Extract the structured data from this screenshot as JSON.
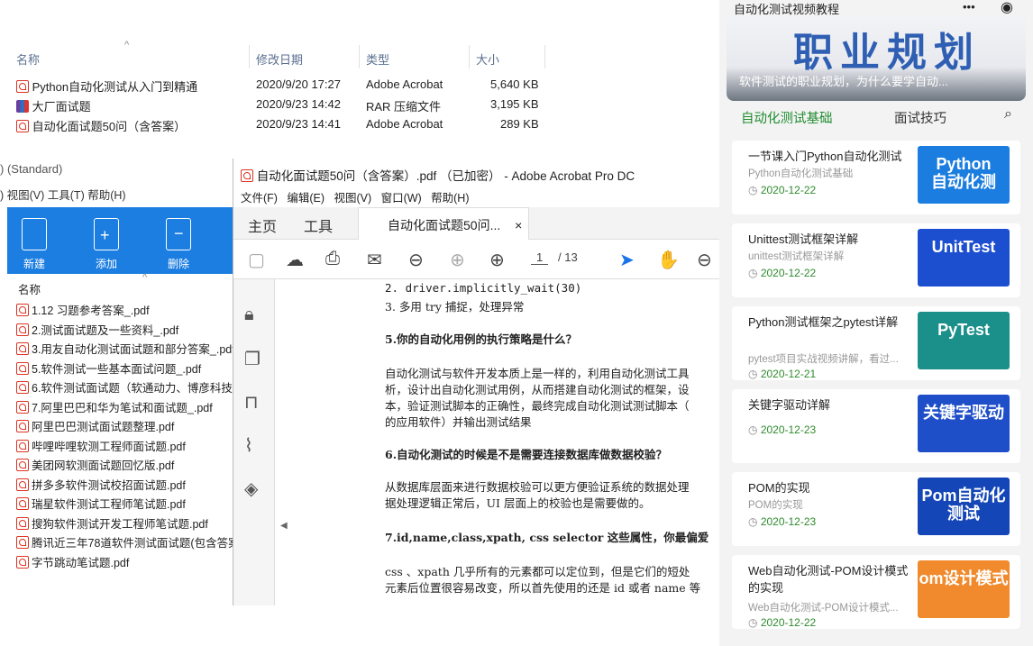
{
  "explorer": {
    "headers": {
      "name": "名称",
      "date": "修改日期",
      "type": "类型",
      "size": "大小"
    },
    "files": [
      {
        "icon": "pdf-icon",
        "name": "Python自动化测试从入门到精通",
        "date": "2020/9/20 17:27",
        "type": "Adobe Acrobat",
        "size": "5,640 KB"
      },
      {
        "icon": "rar-icon",
        "name": "大厂面试题",
        "date": "2020/9/23 14:42",
        "type": "RAR 压缩文件",
        "size": "3,195 KB"
      },
      {
        "icon": "pdf-icon",
        "name": "自动化面试题50问（含答案）",
        "date": "2020/9/23 14:41",
        "type": "Adobe Acrobat",
        "size": "289 KB"
      }
    ]
  },
  "win2": {
    "title": ") (Standard)",
    "menu": ") 视图(V) 工具(T) 帮助(H)",
    "ribbon": {
      "new": "新建",
      "add": "添加",
      "delete": "删除"
    },
    "list_header": "名称",
    "files": [
      "1.12 习题参考答案_.pdf",
      "2.测试面试题及一些资料_.pdf",
      "3.用友自动化测试面试题和部分答案_.pdf",
      "5.软件测试一些基本面试问题_.pdf",
      "6.软件测试面试题（软通动力、博彦科技、",
      "7.阿里巴巴和华为笔试和面试题_.pdf",
      "阿里巴巴测试面试题整理.pdf",
      "哔哩哔哩软测工程师面试题.pdf",
      "美团网软测面试题回忆版.pdf",
      "拼多多软件测试校招面试题.pdf",
      "瑞星软件测试工程师笔试题.pdf",
      "搜狗软件测试开发工程师笔试题.pdf",
      "腾讯近三年78道软件测试面试题(包含答案",
      "字节跳动笔试题.pdf"
    ]
  },
  "acrobat": {
    "title": "自动化面试题50问（含答案）.pdf （已加密） - Adobe Acrobat Pro DC",
    "menu": [
      "文件(F)",
      "编辑(E)",
      "视图(V)",
      "窗口(W)",
      "帮助(H)"
    ],
    "tab_home": "主页",
    "tab_tools": "工具",
    "doc_tab": "自动化面试题50问...",
    "tab_close": "×",
    "page_current": "1",
    "page_total": "/ 13",
    "content": {
      "l1": "2. driver.implicitly_wait(30)",
      "l2": "3. 多用 try 捕捉，处理异常",
      "h5": "5.你的自动化用例的执行策略是什么？",
      "p5a": "自动化测试与软件开发本质上是一样的，利用自动化测试工具",
      "p5b": "析，设计出自动化测试用例，从而搭建自动化测试的框架，设",
      "p5c": "本，验证测试脚本的正确性，最终完成自动化测试测试脚本（",
      "p5d": "的应用软件）并输出测试结果",
      "h6": "6.自动化测试的时候是不是需要连接数据库做数据校验？",
      "p6a": "从数据库层面来进行数据校验可以更方便验证系统的数据处理",
      "p6b": "据处理逻辑正常后，UI 层面上的校验也是需要做的。",
      "h7": "7.id,name,class,xpath, css selector 这些属性，你最偏爱",
      "p7a": "css 、xpath 几乎所有的元素都可以定位到，但是它们的短处",
      "p7b": "元素后位置很容易改变，所以首先使用的还是 id 或者 name 等"
    }
  },
  "phone": {
    "title": "自动化测试视频教程",
    "menu_dots": "•••",
    "banner_big": "职业规划",
    "banner_caption": "软件测试的职业规划，为什么要学自动...",
    "tabs": {
      "active": "自动化测试基础",
      "other": "面试技巧"
    },
    "cards": [
      {
        "title": "一节课入门Python自动化测试",
        "sub": "Python自动化测试基础",
        "date": "2020-12-22",
        "thumb": "Python\n自动化测",
        "thumb_bg": "#1a7ddf"
      },
      {
        "title": "Unittest测试框架详解",
        "sub": "unittest测试框架详解",
        "date": "2020-12-22",
        "thumb": "UnitTest",
        "thumb_bg": "#1c4fcf"
      },
      {
        "title": "Python测试框架之pytest详解",
        "sub": "pytest项目实战视频讲解，看过...",
        "date": "2020-12-21",
        "thumb": "PyTest",
        "thumb_bg": "#1b8f8a"
      },
      {
        "title": "关键字驱动详解",
        "sub": "",
        "date": "2020-12-23",
        "thumb": "关键字驱动",
        "thumb_bg": "#1e4fc8"
      },
      {
        "title": "POM的实现",
        "sub": "POM的实现",
        "date": "2020-12-23",
        "thumb": "Pom自动化测试",
        "thumb_bg": "#1546b8"
      },
      {
        "title": "Web自动化测试-POM设计模式的实现",
        "sub": "Web自动化测试-POM设计模式...",
        "date": "2020-12-22",
        "thumb": "om设计模式",
        "thumb_bg": "#f08a2c"
      }
    ]
  }
}
